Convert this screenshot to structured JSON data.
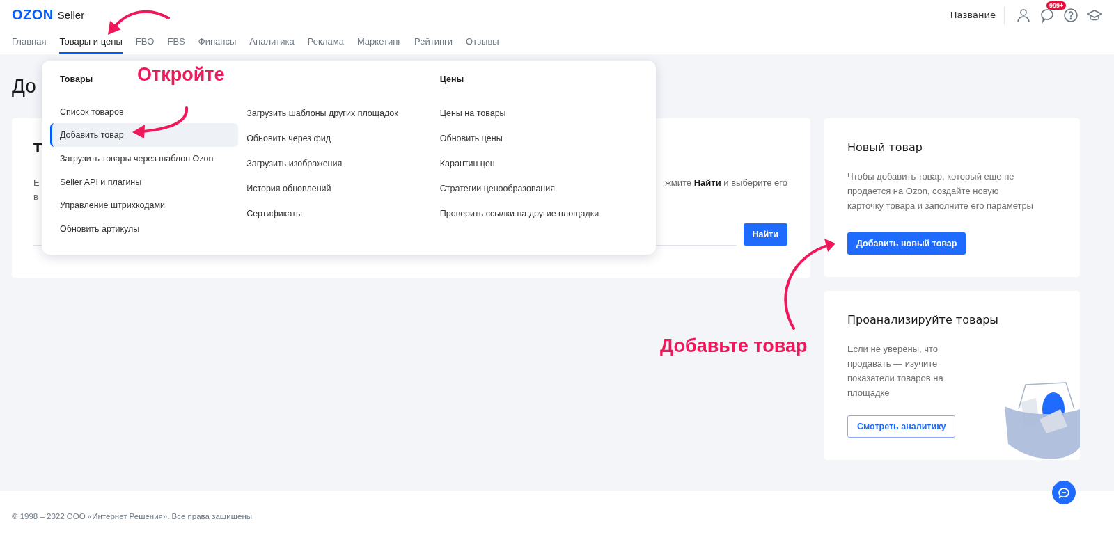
{
  "header": {
    "logo": "OZON",
    "logo_suffix": "Seller",
    "account": "Название",
    "badge": "999+"
  },
  "nav": [
    {
      "label": "Главная",
      "selected": false
    },
    {
      "label": "Товары и цены",
      "selected": true
    },
    {
      "label": "FBO",
      "selected": false
    },
    {
      "label": "FBS",
      "selected": false
    },
    {
      "label": "Финансы",
      "selected": false
    },
    {
      "label": "Аналитика",
      "selected": false
    },
    {
      "label": "Реклама",
      "selected": false
    },
    {
      "label": "Маркетинг",
      "selected": false
    },
    {
      "label": "Рейтинги",
      "selected": false
    },
    {
      "label": "Отзывы",
      "selected": false
    }
  ],
  "page_title": "До",
  "search_card": {
    "title": "Т",
    "text_left_1": "Е",
    "text_left_2": "в",
    "text_right": "жмите **Найти** и выберите его",
    "button": "Найти"
  },
  "menu": {
    "columns": [
      {
        "heading": "Товары",
        "items": [
          {
            "label": "Список товаров",
            "selected": false
          },
          {
            "label": "Добавить товар",
            "selected": true
          },
          {
            "label": "Загрузить товары через шаблон Ozon",
            "selected": false
          },
          {
            "label": "Seller API и плагины",
            "selected": false
          },
          {
            "label": "Управление штрихкодами",
            "selected": false
          },
          {
            "label": "Обновить артикулы",
            "selected": false
          }
        ]
      },
      {
        "items": [
          {
            "label": "Загрузить шаблоны других площадок",
            "selected": false
          },
          {
            "label": "Обновить через фид",
            "selected": false
          },
          {
            "label": "Загрузить изображения",
            "selected": false
          },
          {
            "label": "История обновлений",
            "selected": false
          },
          {
            "label": "Сертификаты",
            "selected": false
          }
        ]
      },
      {
        "heading": "Цены",
        "items": [
          {
            "label": "Цены на товары",
            "selected": false
          },
          {
            "label": "Обновить цены",
            "selected": false
          },
          {
            "label": "Карантин цен",
            "selected": false
          },
          {
            "label": "Стратегии ценообразования",
            "selected": false
          },
          {
            "label": "Проверить ссылки на другие площадки",
            "selected": false
          }
        ]
      }
    ]
  },
  "new_product": {
    "title": "Новый товар",
    "text": "Чтобы добавить товар, который еще не продается на Ozon, создайте новую карточку товара и заполните его параметры",
    "button": "Добавить новый товар"
  },
  "analyze": {
    "title": "Проанализируйте товары",
    "text": "Если не уверены, что продавать — изучите показатели товаров на площадке",
    "button": "Смотреть аналитику"
  },
  "footer": "© 1998 – 2022 ООО «Интернет Решения». Все права защищены",
  "annotations": [
    {
      "text": "Откройте"
    },
    {
      "text": "Добавьте товар"
    }
  ]
}
